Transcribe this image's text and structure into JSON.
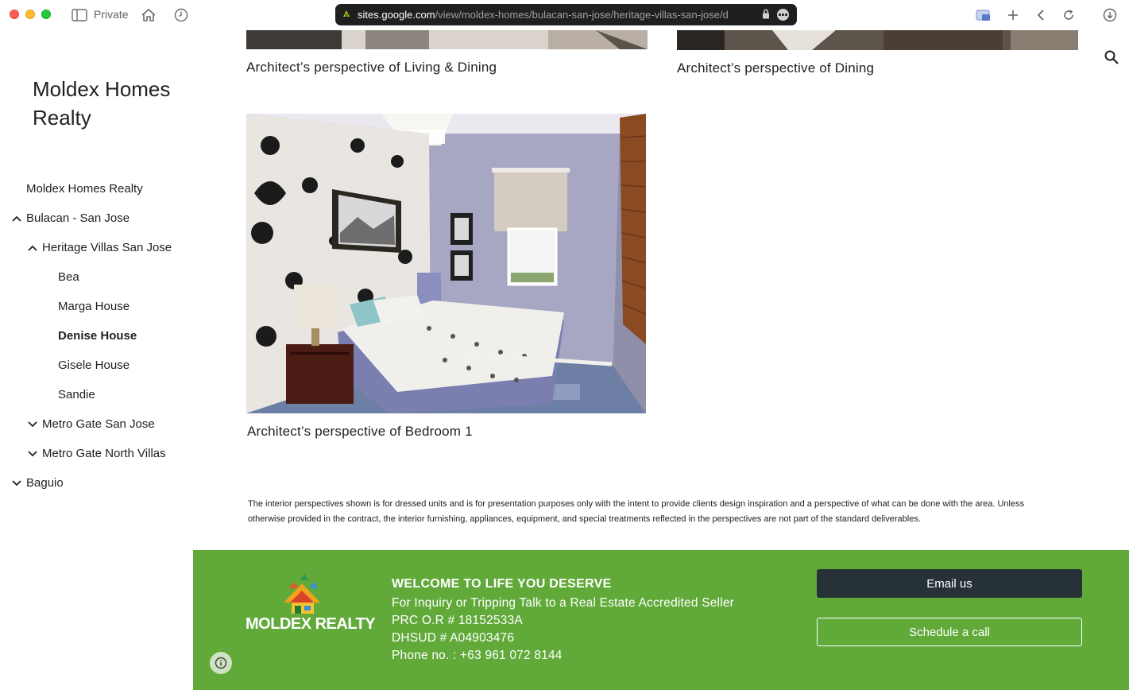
{
  "browser": {
    "private_label": "Private",
    "url_domain": "sites.google.com",
    "url_path": "/view/moldex-homes/bulacan-san-jose/heritage-villas-san-jose/d"
  },
  "sidebar": {
    "site_title": "Moldex Homes Realty",
    "items": [
      {
        "label": "Moldex Homes Realty"
      },
      {
        "label": "Bulacan - San Jose"
      },
      {
        "label": "Heritage Villas San Jose"
      },
      {
        "label": "Bea"
      },
      {
        "label": "Marga House"
      },
      {
        "label": "Denise House"
      },
      {
        "label": "Gisele House"
      },
      {
        "label": "Sandie"
      },
      {
        "label": "Metro Gate San Jose"
      },
      {
        "label": "Metro Gate North Villas"
      },
      {
        "label": "Baguio"
      }
    ]
  },
  "main": {
    "caption_living": "Architect’s perspective of Living & Dining",
    "caption_dining": "Architect’s perspective of Dining",
    "caption_bedroom": "Architect’s perspective of Bedroom 1",
    "disclaimer": "The interior perspectives shown is for dressed units and is for presentation purposes only with the intent to provide clients design inspiration and a perspective of what can be done with the area. Unless otherwise provided in the contract, the interior furnishing, appliances, equipment, and special treatments reflected in the perspectives are not part of the standard deliverables."
  },
  "footer": {
    "logo_text": "MOLDEX REALTY",
    "heading": "WELCOME TO LIFE YOU DESERVE",
    "line1": "For Inquiry or Tripping Talk to a Real Estate Accredited Seller",
    "line2": "PRC O.R # 18152533A",
    "line3": "DHSUD # A04903476",
    "line4": "Phone no. : +63 961 072 8144",
    "email_button": "Email us",
    "call_button": "Schedule a call"
  },
  "colors": {
    "footer_green": "#61aa3a",
    "email_button_bg": "#263238"
  }
}
